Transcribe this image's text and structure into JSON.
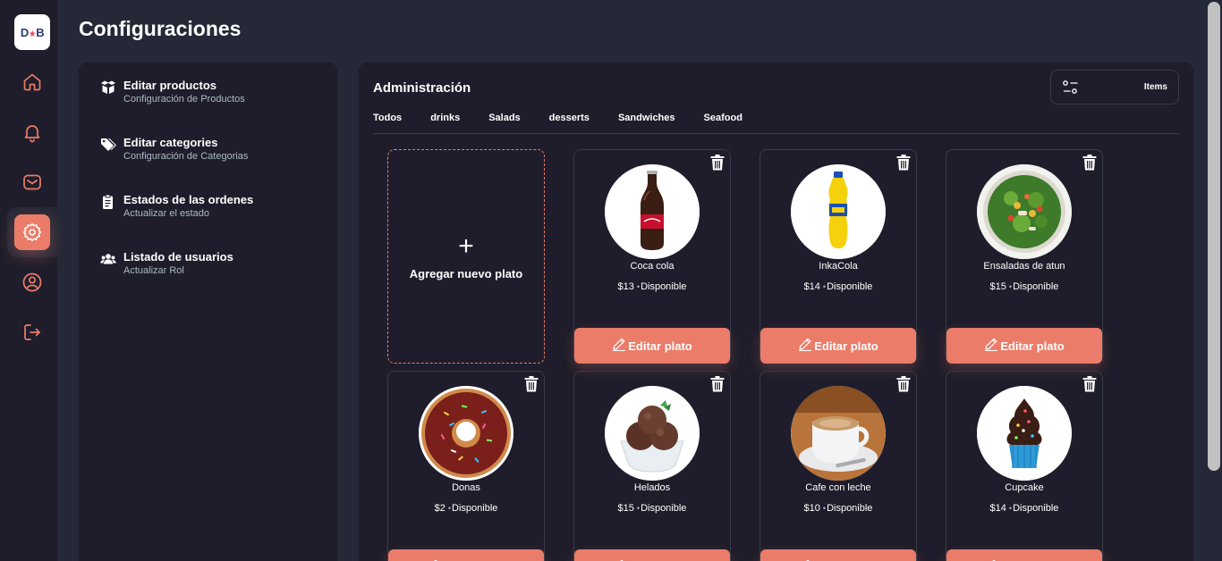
{
  "app": {
    "logo_text_left": "D",
    "logo_star": "★",
    "logo_text_right": "B",
    "accent_color": "#ea7c69"
  },
  "sidebar": {
    "items": [
      {
        "name": "home-icon",
        "active": false
      },
      {
        "name": "bell-icon",
        "active": false
      },
      {
        "name": "mail-icon",
        "active": false
      },
      {
        "name": "gear-icon",
        "active": true
      },
      {
        "name": "user-icon",
        "active": false
      },
      {
        "name": "logout-icon",
        "active": false
      }
    ]
  },
  "header": {
    "title": "Configuraciones"
  },
  "settings": {
    "items": [
      {
        "title": "Editar productos",
        "subtitle": "Configuración de Productos",
        "icon": "box-icon"
      },
      {
        "title": "Editar categories",
        "subtitle": "Configuración de Categorias",
        "icon": "tags-icon"
      },
      {
        "title": "Estados de las ordenes",
        "subtitle": "Actualizar el estado",
        "icon": "clipboard-icon"
      },
      {
        "title": "Listado de usuarios",
        "subtitle": "Actualizar Rol",
        "icon": "users-icon"
      }
    ]
  },
  "admin": {
    "title": "Administración",
    "items_button": "Items",
    "tabs": [
      "Todos",
      "drinks",
      "Salads",
      "desserts",
      "Sandwiches",
      "Seafood"
    ],
    "add_label": "Agregar nuevo plato",
    "add_symbol": "+",
    "edit_label": "Editar plato",
    "status_dot": "•",
    "products": [
      {
        "name": "Coca cola",
        "price": "$13",
        "status": "Disponible"
      },
      {
        "name": "InkaCola",
        "price": "$14",
        "status": "Disponible"
      },
      {
        "name": "Ensaladas de atun",
        "price": "$15",
        "status": "Disponible"
      },
      {
        "name": "Donas",
        "price": "$2",
        "status": "Disponible"
      },
      {
        "name": "Helados",
        "price": "$15",
        "status": "Disponible"
      },
      {
        "name": "Cafe con leche",
        "price": "$10",
        "status": "Disponible"
      },
      {
        "name": "Cupcake",
        "price": "$14",
        "status": "Disponible"
      }
    ]
  }
}
